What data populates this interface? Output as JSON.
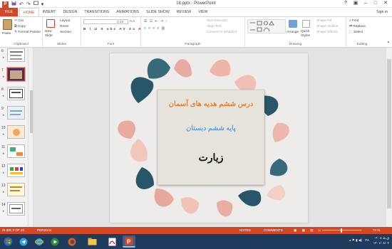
{
  "window": {
    "title": "18.pptx - PowerPoint",
    "signin": "Sign in"
  },
  "qat": {
    "undo": "↶",
    "redo": "↷",
    "more": "▾"
  },
  "tabs": [
    "FILE",
    "HOME",
    "INSERT",
    "DESIGN",
    "TRANSITIONS",
    "ANIMATIONS",
    "SLIDE SHOW",
    "REVIEW",
    "VIEW"
  ],
  "ribbon": {
    "clipboard": {
      "label": "Clipboard",
      "paste": "Paste",
      "cut": "Cut",
      "copy": "Copy",
      "painter": "Format Painter"
    },
    "slides": {
      "label": "Slides",
      "new_slide": "New Slide",
      "layout": "Layout",
      "reset": "Reset",
      "section": "Section"
    },
    "font": {
      "label": "Font",
      "size": "24",
      "buttons": [
        "B",
        "I",
        "U",
        "S",
        "abc",
        "AV",
        "Aa",
        "A"
      ]
    },
    "paragraph": {
      "label": "Paragraph",
      "text_direction": "Text Direction",
      "align_text": "Align Text",
      "smartart": "Convert to SmartArt"
    },
    "drawing": {
      "label": "Drawing",
      "arrange": "Arrange",
      "quick_styles": "Quick Styles",
      "shape_fill": "Shape Fill",
      "shape_outline": "Shape Outline",
      "shape_effects": "Shape Effects"
    },
    "editing": {
      "label": "Editing",
      "find": "Find",
      "replace": "Replace",
      "select": "Select"
    }
  },
  "thumbnails": [
    {
      "num": "6"
    },
    {
      "num": "7"
    },
    {
      "num": "8"
    },
    {
      "num": "9"
    },
    {
      "num": "10"
    },
    {
      "num": "11"
    },
    {
      "num": "12"
    },
    {
      "num": "13"
    },
    {
      "num": "14"
    }
  ],
  "slide": {
    "line1": "درس ششم هدیه های آسمان",
    "line2": "پایه ششم دبستان",
    "line3": "زیارت"
  },
  "status": {
    "slide_info": "SLIDE 2 OF 23",
    "language": "PERSIAN",
    "notes": "NOTES",
    "comments": "COMMENTS",
    "zoom": "74 %"
  },
  "taskbar": {
    "time": "۰۲:۰۸ ق.ظ",
    "date": "۱۴۰۱/۰۸/۰۴",
    "lang": "FA"
  },
  "colors": {
    "accent": "#d24726",
    "title_orange": "#e07a2a",
    "title_blue": "#5b9bd5",
    "taskbar": "#1e3a5c"
  }
}
